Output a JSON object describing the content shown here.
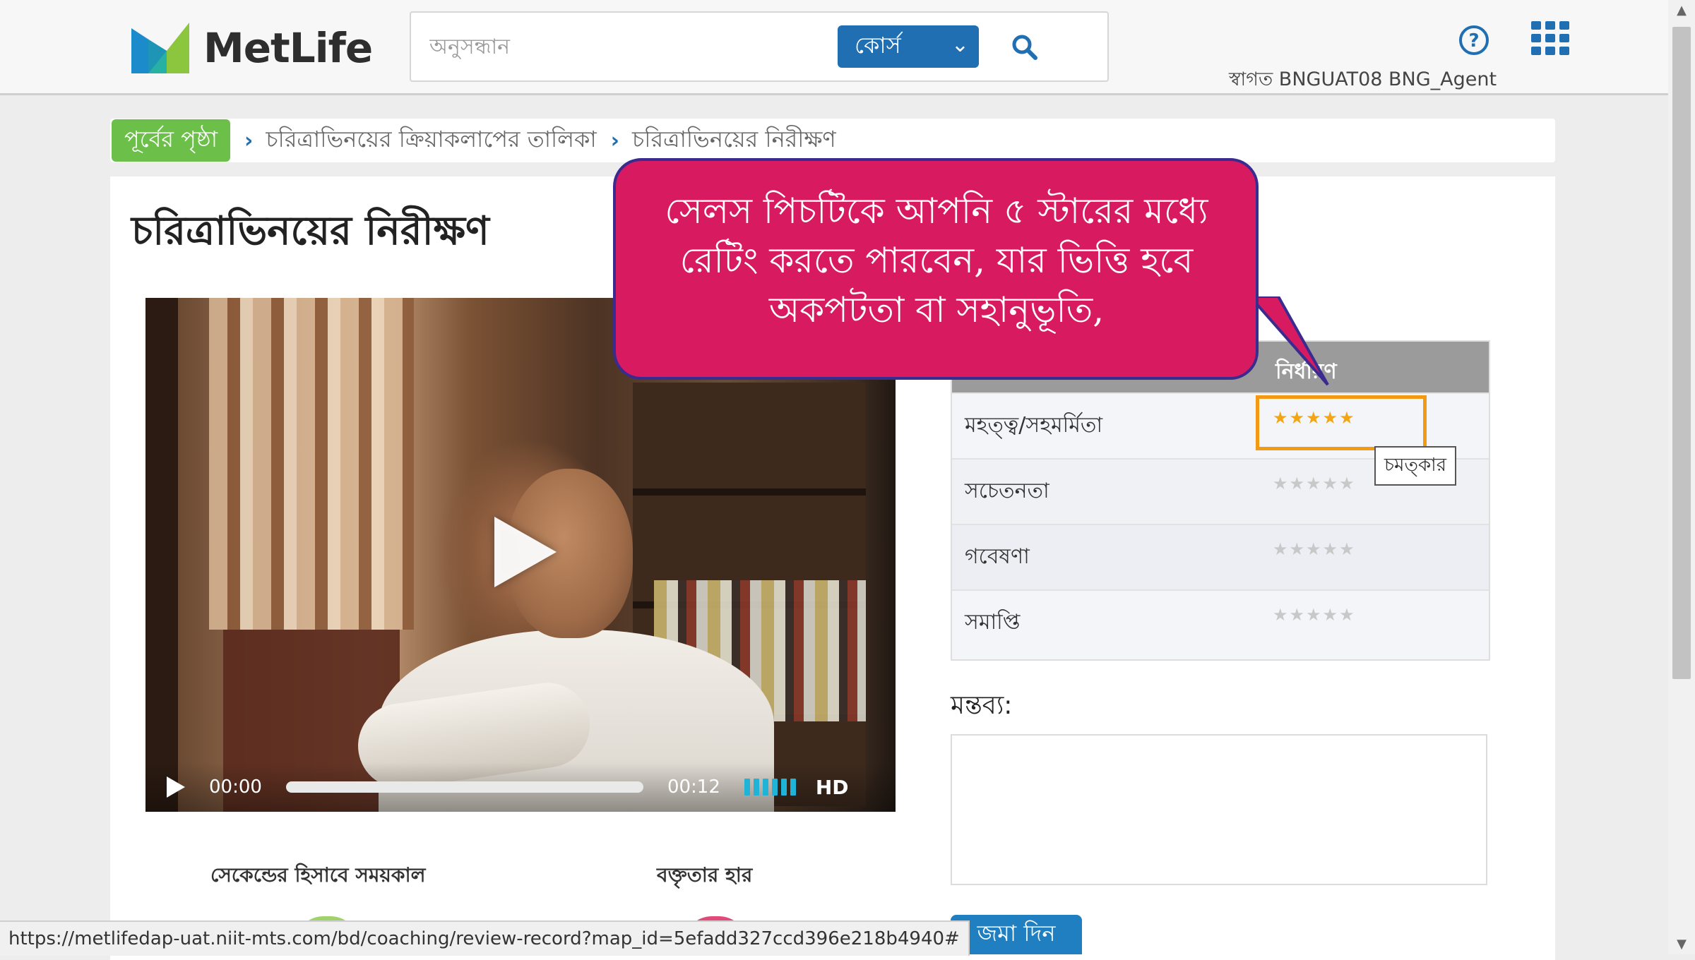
{
  "app": {
    "logo_text": "MetLife",
    "welcome": "স্বাগত BNGUAT08 BNG_Agent",
    "accent": "#1f6fb2"
  },
  "search": {
    "placeholder": "অনুসন্ধান",
    "scope_label": "কোর্স",
    "icon": "search-icon"
  },
  "breadcrumb": {
    "back_label": "পূর্বের পৃষ্ঠা",
    "items": [
      "চরিত্রাভিনয়ের ক্রিয়াকলাপের তালিকা",
      "চরিত্রাভিনয়ের নিরীক্ষণ"
    ]
  },
  "page": {
    "title": "চরিত্রাভিনয়ের নিরীক্ষণ"
  },
  "video": {
    "current_time": "00:00",
    "duration": "00:12",
    "quality": "HD",
    "progress": 0.0,
    "volume_bars": 6
  },
  "metrics": {
    "duration_label": "সেকেন্ডের হিসাবে সময়কাল",
    "speech_rate_label": "বক্তৃতার হার"
  },
  "rating": {
    "header": "নির্ধারণ",
    "max_stars": 5,
    "rows": [
      {
        "label": "মহত্ত্ব/সহমর্মিতা",
        "stars": 5
      },
      {
        "label": "সচেতনতা",
        "stars": 0
      },
      {
        "label": "গবেষণা",
        "stars": 0
      },
      {
        "label": "সমাপ্তি",
        "stars": 0
      }
    ],
    "tooltip": "চমত্কার",
    "star_color_on": "#f2a614",
    "star_color_off": "#c8c8c8"
  },
  "callout": {
    "text": "সেলস পিচটিকে আপনি ৫ স্টারের মধ্যে রেটিং করতে পারবেন, যার ভিত্তি হবে অকপটতা বা সহানুভূতি,",
    "color": "#d81b60"
  },
  "comments": {
    "label": "মন্তব্য:",
    "value": ""
  },
  "submit": {
    "label": "জমা দিন"
  },
  "status": {
    "url": "https://metlifedap-uat.niit-mts.com/bd/coaching/review-record?map_id=5efadd327ccd396e218b4940#"
  }
}
